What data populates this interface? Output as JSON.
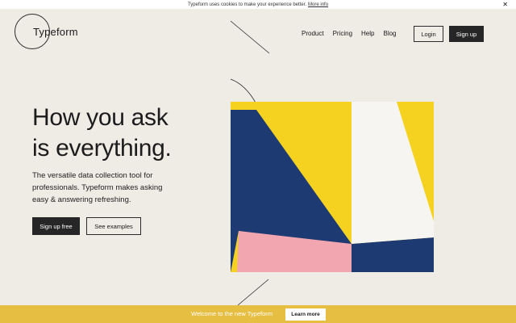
{
  "cookie_bar": {
    "text": "Typeform uses cookies to make your experience better.",
    "link": "More info",
    "close": "✕"
  },
  "header": {
    "logo": "Typeform",
    "nav": [
      "Product",
      "Pricing",
      "Help",
      "Blog"
    ],
    "login": "Login",
    "signup": "Sign up"
  },
  "hero": {
    "headline_line1": "How you ask",
    "headline_line2": "is everything.",
    "subtitle": "The versatile data collection tool for professionals. Typeform makes asking easy & answering refreshing.",
    "cta_primary": "Sign up free",
    "cta_secondary": "See examples",
    "art_colors": {
      "navy": "#1e3a73",
      "yellow": "#f4d21f",
      "white": "#f7f5f2",
      "pink": "#f2a7b0"
    }
  },
  "banner": {
    "text": "Welcome to the new Typeform",
    "button": "Learn more",
    "color": "#e6be41"
  }
}
